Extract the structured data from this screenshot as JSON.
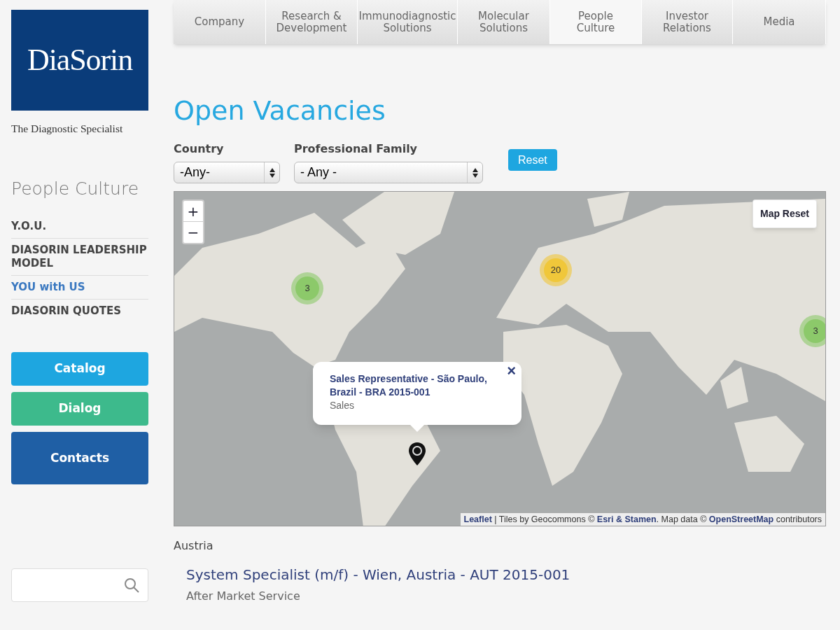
{
  "logo": {
    "wordmark": "DiaSorin",
    "tagline": "The Diagnostic Specialist"
  },
  "nav": [
    {
      "label": "Company",
      "selected": false
    },
    {
      "label": "Research & Development",
      "selected": false
    },
    {
      "label": "Immunodiagnostic Solutions",
      "selected": false
    },
    {
      "label": "Molecular Solutions",
      "selected": false
    },
    {
      "label": "People Culture",
      "selected": true
    },
    {
      "label": "Investor Relations",
      "selected": false
    },
    {
      "label": "Media",
      "selected": false
    }
  ],
  "sidebar": {
    "title": "People Culture",
    "items": [
      {
        "label": "Y.O.U.",
        "selected": false
      },
      {
        "label": "DIASORIN LEADERSHIP MODEL",
        "selected": false
      },
      {
        "label": "YOU with US",
        "selected": true
      },
      {
        "label": "DIASORIN QUOTES",
        "selected": false
      }
    ],
    "buttons": [
      {
        "label": "Catalog",
        "color": "#1ea6e0"
      },
      {
        "label": "Dialog",
        "color": "#3dba8c"
      },
      {
        "label": "Contacts",
        "color": "#1f5fa5"
      }
    ]
  },
  "page_title": "Open Vacancies",
  "filters": [
    {
      "label": "Country",
      "value": "-Any-"
    },
    {
      "label": "Professional Family",
      "value": "- Any -"
    }
  ],
  "reset_button": "Reset",
  "map": {
    "zoom_in": "+",
    "zoom_out": "−",
    "map_reset": "Map Reset",
    "clusters": [
      {
        "count": "3",
        "color": "#8cc96a"
      },
      {
        "count": "20",
        "color": "#f0c73a"
      },
      {
        "count": "3",
        "color": "#8cc96a"
      }
    ],
    "popup": {
      "title": "Sales Representative - São Paulo, Brazil - BRA 2015-001",
      "subtitle": "Sales",
      "close": "×"
    },
    "attribution": [
      {
        "kind": "link",
        "text": "Leaflet"
      },
      {
        "kind": "text",
        "text": " | Tiles by Geocommons © "
      },
      {
        "kind": "link",
        "text": "Esri & Stamen"
      },
      {
        "kind": "text",
        "text": ". Map data © "
      },
      {
        "kind": "link",
        "text": "OpenStreetMap"
      },
      {
        "kind": "text",
        "text": " contributors"
      }
    ]
  },
  "groups": [
    {
      "country": "Austria",
      "jobs": [
        {
          "title": "System Specialist (m/f) - Wien, Austria - AUT 2015-001",
          "family": "After Market Service"
        }
      ]
    }
  ]
}
